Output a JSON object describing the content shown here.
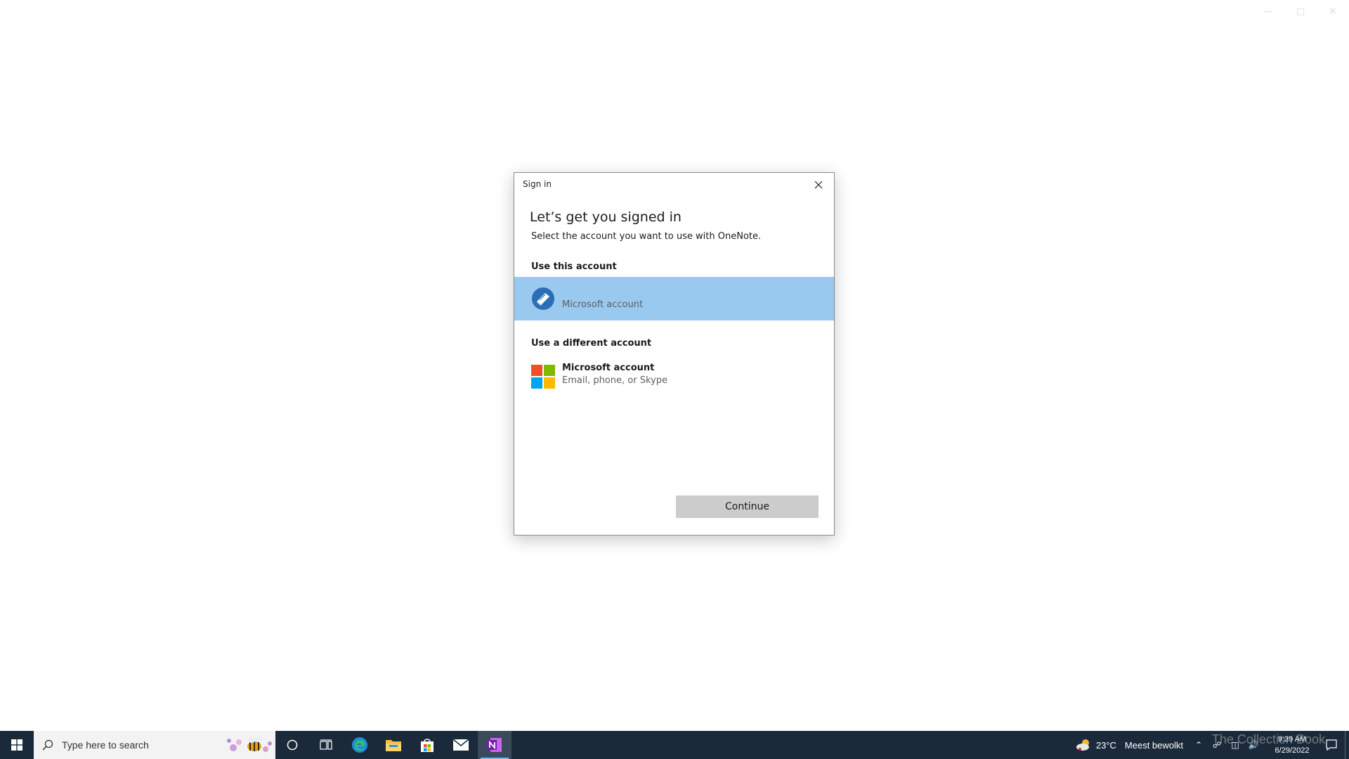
{
  "dialog": {
    "title": "Sign in",
    "heading": "Let’s get you signed in",
    "subtext": "Select the account you want to use with OneNote.",
    "use_this_account_label": "Use this account",
    "selected_account": {
      "name": "Microsoft account"
    },
    "use_different_label": "Use a different account",
    "other_account": {
      "name": "Microsoft account",
      "subtitle": "Email, phone, or Skype"
    },
    "continue_label": "Continue"
  },
  "taskbar": {
    "search_placeholder": "Type here to search",
    "weather": {
      "temperature": "23°C",
      "description": "Meest bewolkt"
    },
    "clock": {
      "time": "9:39 AM",
      "date": "6/29/2022"
    },
    "pinned_icons": [
      "cortana-icon",
      "task-view-icon",
      "edge-icon",
      "file-explorer-icon",
      "store-icon",
      "mail-icon",
      "onenote-icon"
    ]
  },
  "watermark": "The Collection Book",
  "colors": {
    "selected_row": "#99c9ef",
    "taskbar": "#1b2a3a",
    "continue_button": "#cccccc",
    "ms_red": "#f25022",
    "ms_green": "#7fba00",
    "ms_blue": "#00a4ef",
    "ms_yellow": "#ffb900",
    "onenote_purple": "#7719aa"
  }
}
